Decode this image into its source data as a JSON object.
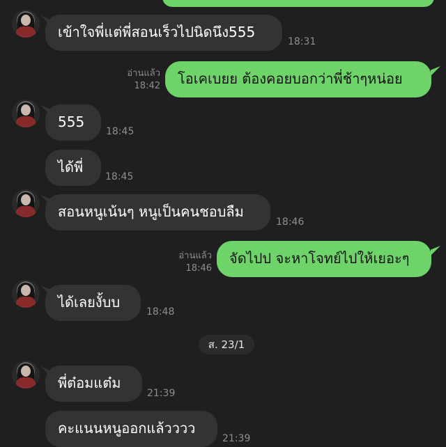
{
  "date_divider": "ส. 23/1",
  "read_label": "อ่านแล้ว",
  "messages": [
    {
      "text": "เข้าใจพี่แต่พี่สอนเร็วไปนิดนึง555",
      "time": "18:31",
      "from": "them"
    },
    {
      "text": "โอเคเบยย ต้องคอยบอกว่าพี่ช้าๆหน่อย",
      "time": "18:42",
      "from": "me",
      "read": "อ่านแล้ว"
    },
    {
      "text": "555",
      "time": "18:45",
      "from": "them"
    },
    {
      "text": "ได้พี่",
      "time": "18:45",
      "from": "them"
    },
    {
      "text": "สอนหนูเน้นๆ หนูเป็นคนชอบลืม",
      "time": "18:46",
      "from": "them"
    },
    {
      "text": "จัดไปป จะหาโจทย์ไปให้เยอะๆ",
      "time": "18:46",
      "from": "me",
      "read": "อ่านแล้ว"
    },
    {
      "text": "ได้เลยงั้บบ",
      "time": "18:48",
      "from": "them"
    },
    {
      "text": "พี่ต๋อมแต๋ม",
      "time": "21:39",
      "from": "them"
    },
    {
      "text": "คะแนนหนูออกแล้วววว",
      "time": "21:39",
      "from": "them"
    }
  ],
  "colors": {
    "background": "#1f1f1f",
    "incoming_bubble": "#333333",
    "outgoing_bubble": "#6ed46a"
  }
}
